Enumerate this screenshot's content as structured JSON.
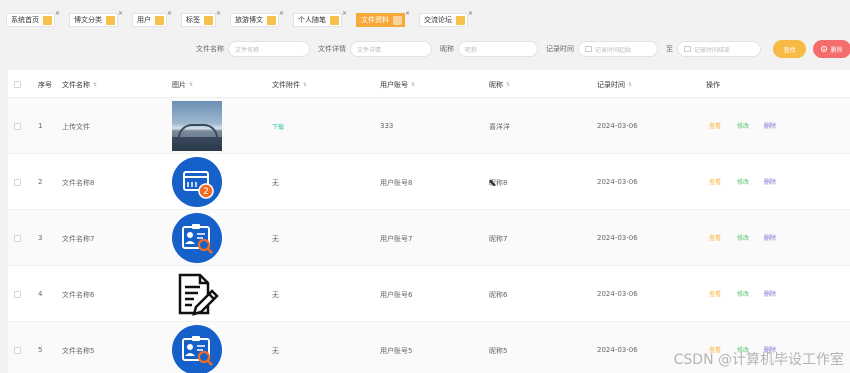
{
  "tabs": [
    {
      "label": "系统首页"
    },
    {
      "label": "博文分类"
    },
    {
      "label": "用户"
    },
    {
      "label": "标签"
    },
    {
      "label": "旅游博文"
    },
    {
      "label": "个人随笔"
    },
    {
      "label": "文件资料"
    },
    {
      "label": "交流论坛"
    }
  ],
  "tab_close_glyph": "×",
  "search": {
    "file_name_label": "文件名称",
    "file_name_placeholder": "文件名称",
    "file_detail_label": "文件详情",
    "file_detail_placeholder": "文件详情",
    "nickname_label": "昵称",
    "nickname_placeholder": "昵称",
    "record_time_label": "记录时间",
    "start_placeholder": "记录时间起始",
    "to_label": "至",
    "end_placeholder": "记录时间结束",
    "search_button": "查找",
    "delete_button": "删除"
  },
  "table": {
    "headers": {
      "index": "序号",
      "file_name": "文件名称",
      "image": "图片",
      "attachment": "文件附件",
      "account": "用户账号",
      "nickname": "昵称",
      "record_time": "记录时间",
      "actions": "操作"
    },
    "sort_glyph": "⇅",
    "actions": {
      "view": "查看",
      "edit": "修改",
      "delete": "删除"
    },
    "rows": [
      {
        "index": "1",
        "file_name": "上传文件",
        "image": "photo",
        "attachment": "下载",
        "account": "333",
        "nickname": "喜洋洋",
        "record_time": "2024-03-06"
      },
      {
        "index": "2",
        "file_name": "文件名称8",
        "image": "card-badge-icon",
        "attachment": "无",
        "account": "用户账号8",
        "nickname": "昵称8",
        "record_time": "2024-03-06"
      },
      {
        "index": "3",
        "file_name": "文件名称7",
        "image": "id-search-icon",
        "attachment": "无",
        "account": "用户账号7",
        "nickname": "昵称7",
        "record_time": "2024-03-06"
      },
      {
        "index": "4",
        "file_name": "文件名称6",
        "image": "document-edit-icon",
        "attachment": "无",
        "account": "用户账号6",
        "nickname": "昵称6",
        "record_time": "2024-03-06"
      },
      {
        "index": "5",
        "file_name": "文件名称5",
        "image": "id-search-icon",
        "attachment": "无",
        "account": "用户账号5",
        "nickname": "昵称5",
        "record_time": "2024-03-06"
      }
    ]
  },
  "watermark": "CSDN @计算机毕设工作室",
  "colors": {
    "accent": "#f7a93b",
    "search": "#f7bb45",
    "delete": "#f46c6c",
    "icon_blue": "#1560c9",
    "link": "#2ec4a4",
    "view": "#f7b340",
    "edit": "#5bc36a",
    "remove": "#8a68d8"
  }
}
